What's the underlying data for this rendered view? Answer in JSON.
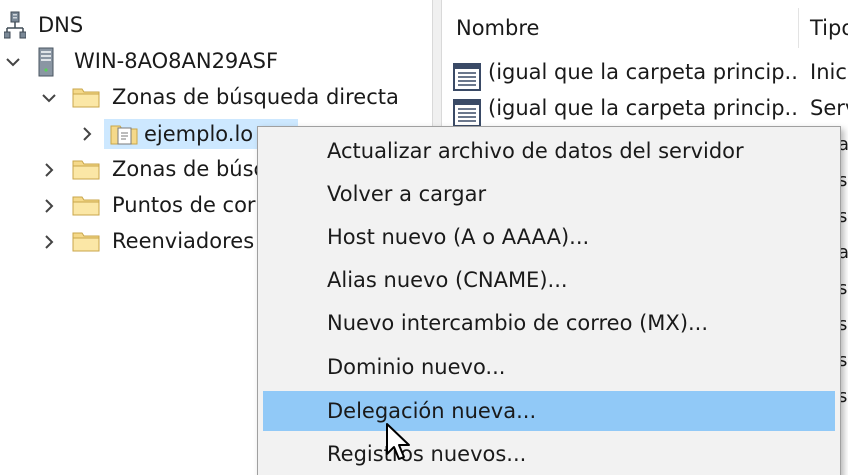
{
  "tree": {
    "root_label": "DNS",
    "server_label": "WIN-8AO8AN29ASF",
    "items": [
      {
        "label": "Zonas de búsqueda directa",
        "expanded": true
      },
      {
        "label": "ejemplo.lo",
        "selected": true
      },
      {
        "label": "Zonas de búsc",
        "expanded": false
      },
      {
        "label": "Puntos de cor",
        "expanded": false
      },
      {
        "label": "Reenviadores",
        "expanded": false
      }
    ]
  },
  "list": {
    "columns": [
      "Nombre",
      "Tipo"
    ],
    "rows": [
      {
        "name": "(igual que la carpeta princip...",
        "type": "Inic"
      },
      {
        "name": "(igual que la carpeta princip...",
        "type": "Serv"
      }
    ],
    "partial_type_letters": [
      "a",
      "s",
      "s",
      "a",
      "s",
      "s",
      "s",
      "s"
    ]
  },
  "context_menu": {
    "items": [
      {
        "label": "Actualizar archivo de datos del servidor",
        "highlighted": false
      },
      {
        "label": "Volver a cargar",
        "highlighted": false
      },
      {
        "label": "Host nuevo (A o AAAA)...",
        "highlighted": false
      },
      {
        "label": "Alias nuevo (CNAME)...",
        "highlighted": false
      },
      {
        "label": "Nuevo intercambio de correo (MX)...",
        "highlighted": false
      },
      {
        "label": "Dominio nuevo...",
        "highlighted": false
      },
      {
        "label": "Delegación nueva...",
        "highlighted": true
      },
      {
        "label": "Registros nuevos...",
        "highlighted": false
      }
    ]
  },
  "colors": {
    "menu_highlight": "#91c9f7",
    "selection": "#cde8ff",
    "menu_background": "#f2f2f2",
    "folder": "#f5d98a"
  },
  "icons": {
    "dns_root": "dns-server-network-icon",
    "server": "server-tower-icon",
    "folder": "folder-icon",
    "zone": "zone-document-folder-icon",
    "record": "dns-record-icon",
    "cursor": "mouse-pointer-icon"
  }
}
